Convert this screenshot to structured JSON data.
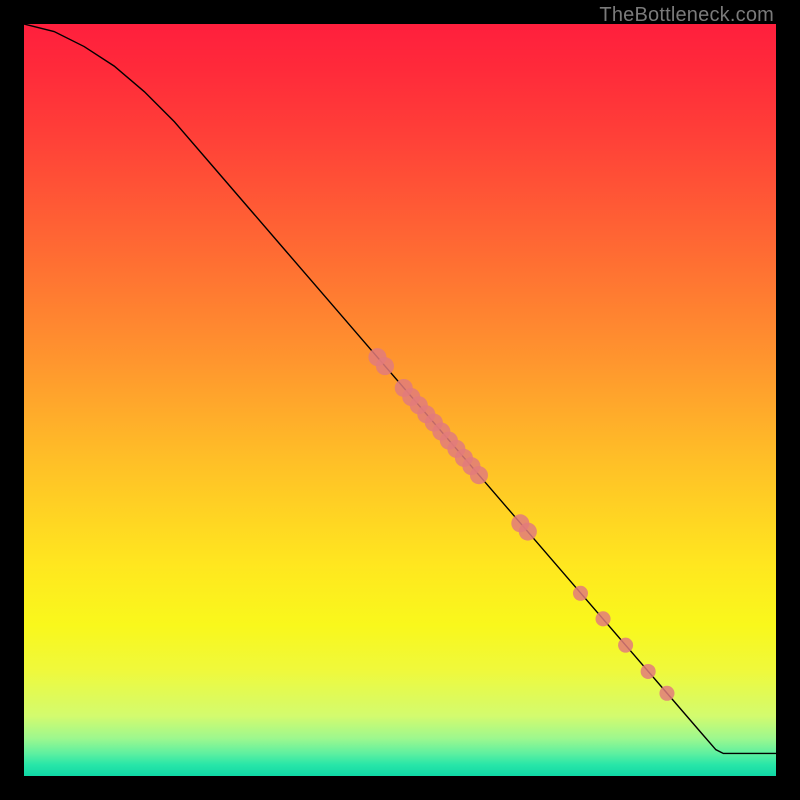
{
  "watermark": "TheBottleneck.com",
  "domain": "Chart",
  "chart_data": {
    "type": "line",
    "title": "",
    "xlabel": "",
    "ylabel": "",
    "xlim": [
      0,
      100
    ],
    "ylim": [
      0,
      100
    ],
    "grid": false,
    "curve": [
      {
        "x": 0,
        "y": 100.0
      },
      {
        "x": 4,
        "y": 99.0
      },
      {
        "x": 8,
        "y": 97.0
      },
      {
        "x": 12,
        "y": 94.4
      },
      {
        "x": 16,
        "y": 91.0
      },
      {
        "x": 20,
        "y": 87.0
      },
      {
        "x": 25,
        "y": 81.2
      },
      {
        "x": 30,
        "y": 75.4
      },
      {
        "x": 35,
        "y": 69.6
      },
      {
        "x": 40,
        "y": 63.8
      },
      {
        "x": 45,
        "y": 58.0
      },
      {
        "x": 50,
        "y": 52.2
      },
      {
        "x": 55,
        "y": 46.4
      },
      {
        "x": 60,
        "y": 40.6
      },
      {
        "x": 65,
        "y": 34.8
      },
      {
        "x": 70,
        "y": 29.0
      },
      {
        "x": 75,
        "y": 23.2
      },
      {
        "x": 80,
        "y": 17.4
      },
      {
        "x": 85,
        "y": 11.6
      },
      {
        "x": 90,
        "y": 5.8
      },
      {
        "x": 92,
        "y": 3.5
      },
      {
        "x": 93,
        "y": 3.0
      },
      {
        "x": 100,
        "y": 3.0
      }
    ],
    "points": [
      {
        "x": 47.0,
        "y": 55.7,
        "r": 1.2
      },
      {
        "x": 48.0,
        "y": 54.5,
        "r": 1.2
      },
      {
        "x": 50.5,
        "y": 51.6,
        "r": 1.2
      },
      {
        "x": 51.5,
        "y": 50.4,
        "r": 1.2
      },
      {
        "x": 52.5,
        "y": 49.3,
        "r": 1.2
      },
      {
        "x": 53.5,
        "y": 48.1,
        "r": 1.2
      },
      {
        "x": 54.5,
        "y": 47.0,
        "r": 1.2
      },
      {
        "x": 55.5,
        "y": 45.8,
        "r": 1.2
      },
      {
        "x": 56.5,
        "y": 44.6,
        "r": 1.2
      },
      {
        "x": 57.5,
        "y": 43.5,
        "r": 1.2
      },
      {
        "x": 58.5,
        "y": 42.3,
        "r": 1.2
      },
      {
        "x": 59.5,
        "y": 41.2,
        "r": 1.2
      },
      {
        "x": 60.5,
        "y": 40.0,
        "r": 1.2
      },
      {
        "x": 66.0,
        "y": 33.6,
        "r": 1.2
      },
      {
        "x": 67.0,
        "y": 32.5,
        "r": 1.2
      },
      {
        "x": 74.0,
        "y": 24.3,
        "r": 1.0
      },
      {
        "x": 77.0,
        "y": 20.9,
        "r": 1.0
      },
      {
        "x": 80.0,
        "y": 17.4,
        "r": 1.0
      },
      {
        "x": 83.0,
        "y": 13.9,
        "r": 1.0
      },
      {
        "x": 85.5,
        "y": 11.0,
        "r": 1.0
      }
    ],
    "point_color": "#e27b7b",
    "line_color": "#000000"
  }
}
